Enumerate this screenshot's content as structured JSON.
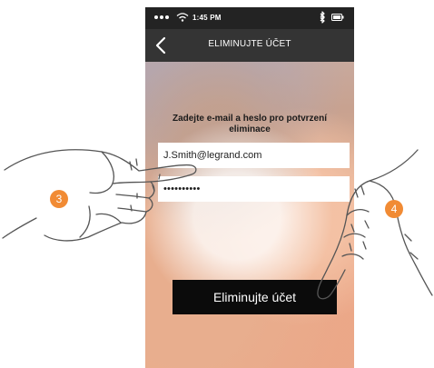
{
  "status_bar": {
    "time": "1:45 PM",
    "signal_icon": "signal-dots-icon",
    "wifi_icon": "wifi-icon",
    "bluetooth_icon": "bluetooth-icon",
    "battery_icon": "battery-icon"
  },
  "header": {
    "back_icon": "chevron-left-icon",
    "title": "ELIMINUJTE ÚČET"
  },
  "form": {
    "instruction": "Zadejte e-mail a heslo pro potvrzení eliminace",
    "email": {
      "value": "J.Smith@legrand.com"
    },
    "password": {
      "masked_value": "••••••••••"
    }
  },
  "actions": {
    "delete_account_label": "Eliminujte účet"
  },
  "annotations": {
    "step_3": "3",
    "step_4": "4"
  },
  "colors": {
    "status_bar": "#232323",
    "header": "#343434",
    "button": "#0b0b0b",
    "step_badge": "#f18b34",
    "hand_outline": "#555555"
  }
}
